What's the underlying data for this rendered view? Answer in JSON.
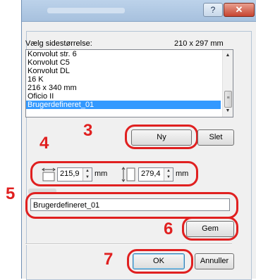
{
  "window": {
    "help_glyph": "?",
    "close_glyph": "✕"
  },
  "page_size": {
    "label": "Vælg sidestørrelse:",
    "dimensions": "210 x 297 mm",
    "items": [
      "Konvolut str. 6",
      "Konvolut C5",
      "Konvolut DL",
      "16 K",
      "216 x 340 mm",
      "Oficio II",
      "Brugerdefineret_01"
    ],
    "selected_index": 6
  },
  "buttons": {
    "new": "Ny",
    "delete": "Slet",
    "save": "Gem",
    "ok": "OK",
    "cancel": "Annuller"
  },
  "size_inputs": {
    "width_value": "215,9",
    "width_unit": "mm",
    "height_value": "279,4",
    "height_unit": "mm"
  },
  "name_field": {
    "value": "Brugerdefineret_01"
  },
  "steps": {
    "s3": "3",
    "s4": "4",
    "s5": "5",
    "s6": "6",
    "s7": "7"
  },
  "colors": {
    "annotation": "#e02020",
    "selection": "#3399ff",
    "titlebar": "#bcd2ea"
  }
}
